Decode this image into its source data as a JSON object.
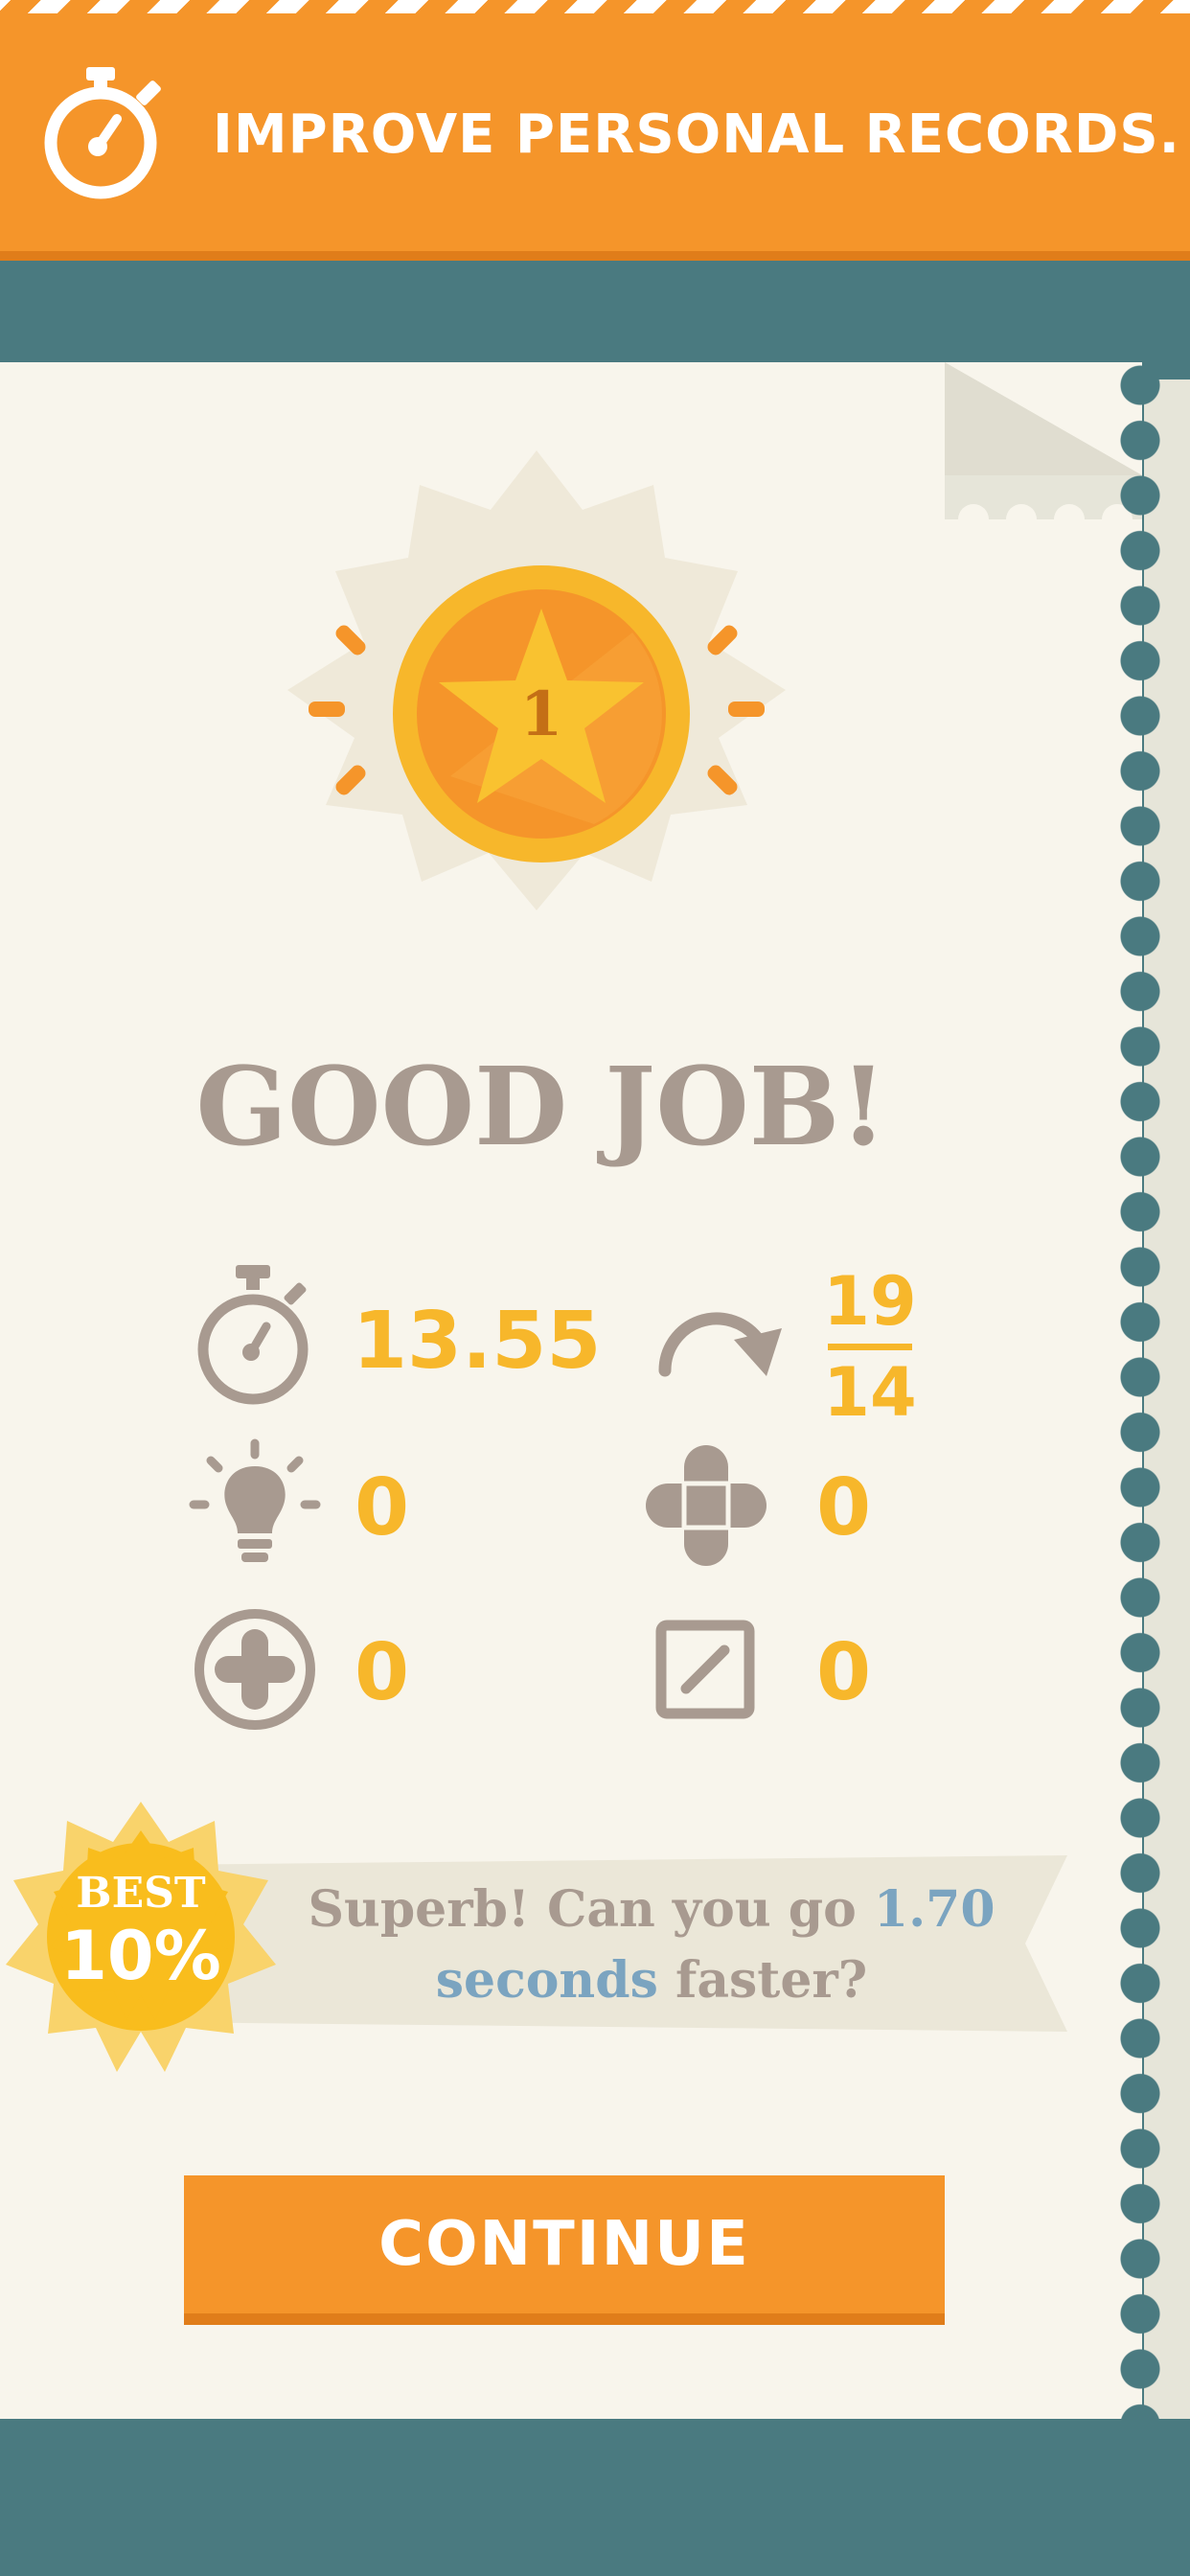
{
  "banner": {
    "icon": "stopwatch-icon",
    "text": "IMPROVE PERSONAL RECORDS."
  },
  "result": {
    "rank_badge": {
      "icon": "gold-star-medal-icon",
      "rank": "1"
    },
    "title": "GOOD JOB!"
  },
  "stats": {
    "time": {
      "icon": "stopwatch-icon",
      "value": "13.55"
    },
    "moves": {
      "icon": "redo-arrow-icon",
      "current": "19",
      "best": "14"
    },
    "hints": {
      "icon": "lightbulb-icon",
      "value": "0"
    },
    "joker": {
      "icon": "cross-puzzle-icon",
      "value": "0"
    },
    "add": {
      "icon": "plus-circle-icon",
      "value": "0"
    },
    "edit": {
      "icon": "pencil-square-icon",
      "value": "0"
    }
  },
  "best": {
    "label": "BEST",
    "percent": "10%",
    "message_prefix": "Superb! Can you go ",
    "message_highlight_1": "1.70",
    "message_highlight_2": "seconds",
    "message_suffix": " faster?"
  },
  "continue_button": {
    "label": "CONTINUE"
  },
  "colors": {
    "accent_orange": "#f5952a",
    "teal": "#4a7a80",
    "paper": "#f8f5ec",
    "stat_yellow": "#f7b72b",
    "text_taupe": "#a89a90",
    "highlight_blue": "#7ba4c0"
  }
}
